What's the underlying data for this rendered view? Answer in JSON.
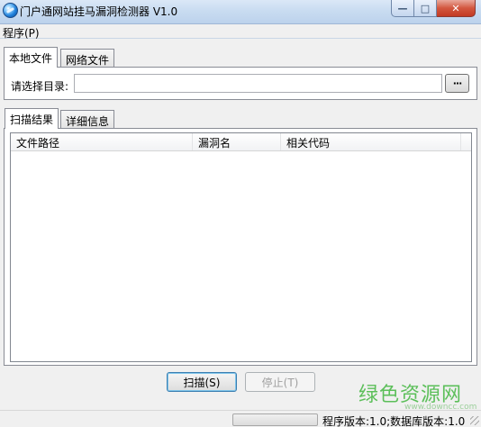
{
  "window": {
    "title": "门户通网站挂马漏洞检测器 V1.0",
    "controls": {
      "minimize": "—",
      "maximize": "□",
      "close": "✕"
    }
  },
  "menubar": {
    "items": [
      {
        "label": "程序(P)"
      }
    ]
  },
  "source_tabs": [
    {
      "label": "本地文件",
      "active": true
    },
    {
      "label": "网络文件",
      "active": false
    }
  ],
  "directory": {
    "label": "请选择目录:",
    "value": "",
    "browse_label": "···"
  },
  "result_tabs": [
    {
      "label": "扫描结果",
      "active": true
    },
    {
      "label": "详细信息",
      "active": false
    }
  ],
  "results_table": {
    "columns": [
      "文件路径",
      "漏洞名",
      "相关代码"
    ],
    "rows": []
  },
  "buttons": {
    "scan": "扫描(S)",
    "stop": "停止(T)"
  },
  "statusbar": {
    "progress": 0,
    "progress_color": "#37b63e",
    "version_text": "程序版本:1.0;数据库版本:1.0"
  },
  "watermark": {
    "text": "绿色资源网",
    "url": "www.downcc.com"
  }
}
